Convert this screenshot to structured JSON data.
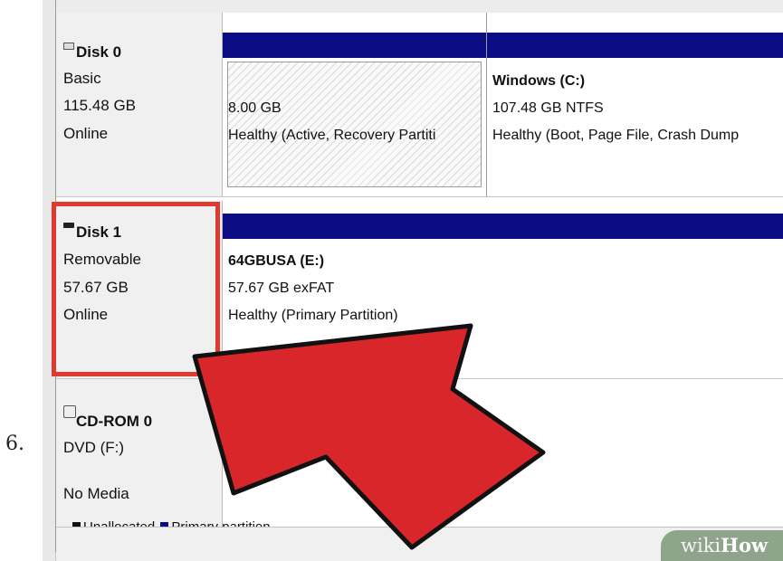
{
  "step_number": "6.",
  "disks": [
    {
      "name": "Disk 0",
      "type": "Basic",
      "size": "115.48 GB",
      "status": "Online",
      "partitions": [
        {
          "label": "",
          "size_fs": "8.00 GB",
          "health": "Healthy (Active, Recovery Partiti"
        },
        {
          "label": "Windows  (C:)",
          "size_fs": "107.48 GB NTFS",
          "health": "Healthy (Boot, Page File, Crash Dump"
        }
      ]
    },
    {
      "name": "Disk 1",
      "type": "Removable",
      "size": "57.67 GB",
      "status": "Online",
      "partitions": [
        {
          "label": "64GBUSA  (E:)",
          "size_fs": "57.67 GB exFAT",
          "health": "Healthy (Primary Partition)"
        }
      ]
    },
    {
      "name": "CD-ROM 0",
      "type": "DVD (F:)",
      "status": "No Media"
    }
  ],
  "legend": [
    {
      "label": "Unallocated",
      "color": "#111111"
    },
    {
      "label": "Primary partition",
      "color": "#0c0c84"
    }
  ],
  "watermark": {
    "part1": "wiki",
    "part2": "How"
  },
  "colors": {
    "partition_bar": "#0c0c84",
    "highlight": "#e03a30",
    "arrow_fill": "#d8262b",
    "arrow_stroke": "#111111"
  }
}
